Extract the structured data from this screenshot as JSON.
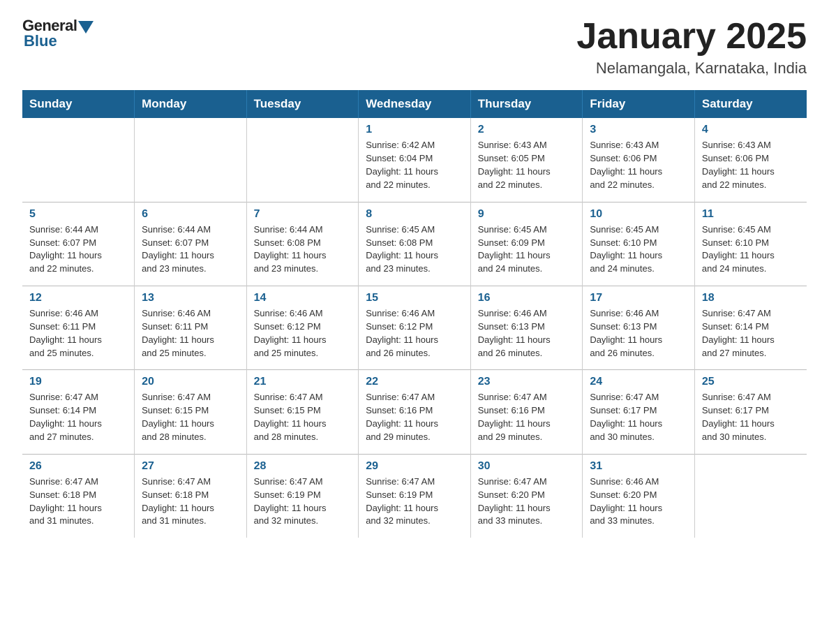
{
  "logo": {
    "text1": "General",
    "text2": "Blue"
  },
  "title": "January 2025",
  "subtitle": "Nelamangala, Karnataka, India",
  "days_of_week": [
    "Sunday",
    "Monday",
    "Tuesday",
    "Wednesday",
    "Thursday",
    "Friday",
    "Saturday"
  ],
  "weeks": [
    [
      {
        "day": "",
        "info": ""
      },
      {
        "day": "",
        "info": ""
      },
      {
        "day": "",
        "info": ""
      },
      {
        "day": "1",
        "info": "Sunrise: 6:42 AM\nSunset: 6:04 PM\nDaylight: 11 hours\nand 22 minutes."
      },
      {
        "day": "2",
        "info": "Sunrise: 6:43 AM\nSunset: 6:05 PM\nDaylight: 11 hours\nand 22 minutes."
      },
      {
        "day": "3",
        "info": "Sunrise: 6:43 AM\nSunset: 6:06 PM\nDaylight: 11 hours\nand 22 minutes."
      },
      {
        "day": "4",
        "info": "Sunrise: 6:43 AM\nSunset: 6:06 PM\nDaylight: 11 hours\nand 22 minutes."
      }
    ],
    [
      {
        "day": "5",
        "info": "Sunrise: 6:44 AM\nSunset: 6:07 PM\nDaylight: 11 hours\nand 22 minutes."
      },
      {
        "day": "6",
        "info": "Sunrise: 6:44 AM\nSunset: 6:07 PM\nDaylight: 11 hours\nand 23 minutes."
      },
      {
        "day": "7",
        "info": "Sunrise: 6:44 AM\nSunset: 6:08 PM\nDaylight: 11 hours\nand 23 minutes."
      },
      {
        "day": "8",
        "info": "Sunrise: 6:45 AM\nSunset: 6:08 PM\nDaylight: 11 hours\nand 23 minutes."
      },
      {
        "day": "9",
        "info": "Sunrise: 6:45 AM\nSunset: 6:09 PM\nDaylight: 11 hours\nand 24 minutes."
      },
      {
        "day": "10",
        "info": "Sunrise: 6:45 AM\nSunset: 6:10 PM\nDaylight: 11 hours\nand 24 minutes."
      },
      {
        "day": "11",
        "info": "Sunrise: 6:45 AM\nSunset: 6:10 PM\nDaylight: 11 hours\nand 24 minutes."
      }
    ],
    [
      {
        "day": "12",
        "info": "Sunrise: 6:46 AM\nSunset: 6:11 PM\nDaylight: 11 hours\nand 25 minutes."
      },
      {
        "day": "13",
        "info": "Sunrise: 6:46 AM\nSunset: 6:11 PM\nDaylight: 11 hours\nand 25 minutes."
      },
      {
        "day": "14",
        "info": "Sunrise: 6:46 AM\nSunset: 6:12 PM\nDaylight: 11 hours\nand 25 minutes."
      },
      {
        "day": "15",
        "info": "Sunrise: 6:46 AM\nSunset: 6:12 PM\nDaylight: 11 hours\nand 26 minutes."
      },
      {
        "day": "16",
        "info": "Sunrise: 6:46 AM\nSunset: 6:13 PM\nDaylight: 11 hours\nand 26 minutes."
      },
      {
        "day": "17",
        "info": "Sunrise: 6:46 AM\nSunset: 6:13 PM\nDaylight: 11 hours\nand 26 minutes."
      },
      {
        "day": "18",
        "info": "Sunrise: 6:47 AM\nSunset: 6:14 PM\nDaylight: 11 hours\nand 27 minutes."
      }
    ],
    [
      {
        "day": "19",
        "info": "Sunrise: 6:47 AM\nSunset: 6:14 PM\nDaylight: 11 hours\nand 27 minutes."
      },
      {
        "day": "20",
        "info": "Sunrise: 6:47 AM\nSunset: 6:15 PM\nDaylight: 11 hours\nand 28 minutes."
      },
      {
        "day": "21",
        "info": "Sunrise: 6:47 AM\nSunset: 6:15 PM\nDaylight: 11 hours\nand 28 minutes."
      },
      {
        "day": "22",
        "info": "Sunrise: 6:47 AM\nSunset: 6:16 PM\nDaylight: 11 hours\nand 29 minutes."
      },
      {
        "day": "23",
        "info": "Sunrise: 6:47 AM\nSunset: 6:16 PM\nDaylight: 11 hours\nand 29 minutes."
      },
      {
        "day": "24",
        "info": "Sunrise: 6:47 AM\nSunset: 6:17 PM\nDaylight: 11 hours\nand 30 minutes."
      },
      {
        "day": "25",
        "info": "Sunrise: 6:47 AM\nSunset: 6:17 PM\nDaylight: 11 hours\nand 30 minutes."
      }
    ],
    [
      {
        "day": "26",
        "info": "Sunrise: 6:47 AM\nSunset: 6:18 PM\nDaylight: 11 hours\nand 31 minutes."
      },
      {
        "day": "27",
        "info": "Sunrise: 6:47 AM\nSunset: 6:18 PM\nDaylight: 11 hours\nand 31 minutes."
      },
      {
        "day": "28",
        "info": "Sunrise: 6:47 AM\nSunset: 6:19 PM\nDaylight: 11 hours\nand 32 minutes."
      },
      {
        "day": "29",
        "info": "Sunrise: 6:47 AM\nSunset: 6:19 PM\nDaylight: 11 hours\nand 32 minutes."
      },
      {
        "day": "30",
        "info": "Sunrise: 6:47 AM\nSunset: 6:20 PM\nDaylight: 11 hours\nand 33 minutes."
      },
      {
        "day": "31",
        "info": "Sunrise: 6:46 AM\nSunset: 6:20 PM\nDaylight: 11 hours\nand 33 minutes."
      },
      {
        "day": "",
        "info": ""
      }
    ]
  ]
}
